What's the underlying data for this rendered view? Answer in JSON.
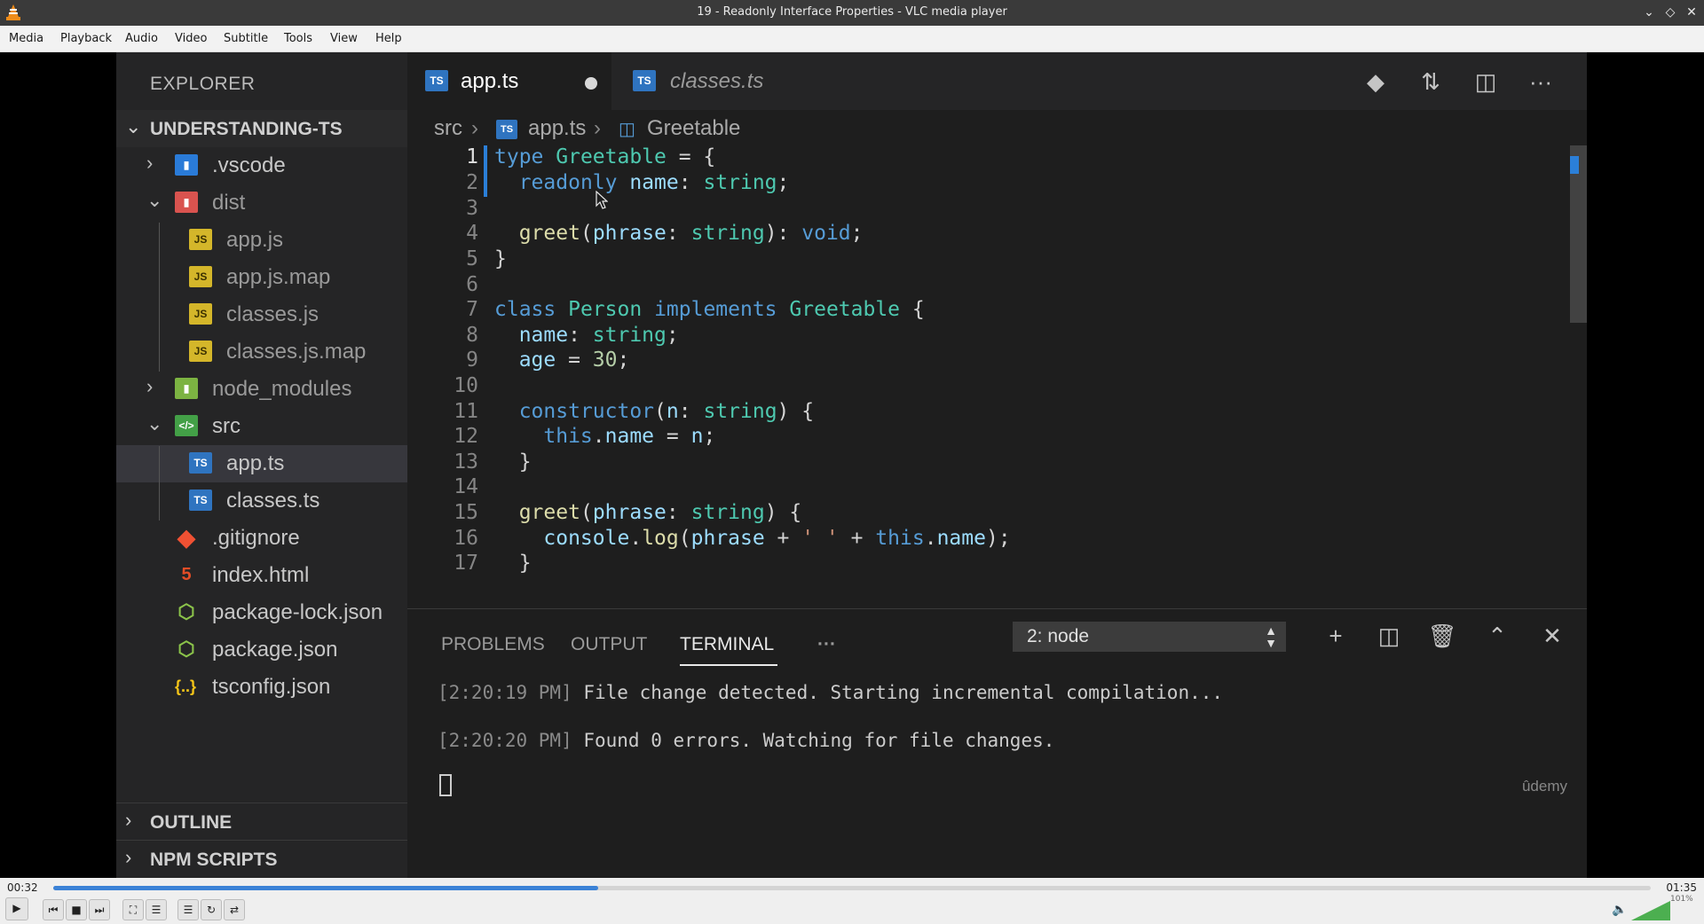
{
  "window": {
    "title": "19 - Readonly Interface Properties - VLC media player"
  },
  "menu": [
    "Media",
    "Playback",
    "Audio",
    "Video",
    "Subtitle",
    "Tools",
    "View",
    "Help"
  ],
  "explorer": {
    "title": "EXPLORER",
    "project": "UNDERSTANDING-TS",
    "items": [
      {
        "label": ".vscode",
        "icon": "folder-vscode-icon"
      },
      {
        "label": "dist",
        "icon": "folder-dist-icon"
      },
      {
        "label": "app.js",
        "icon": "js-file-icon",
        "badge": "JS"
      },
      {
        "label": "app.js.map",
        "icon": "js-map-file-icon",
        "badge": "JS"
      },
      {
        "label": "classes.js",
        "icon": "js-file-icon",
        "badge": "JS"
      },
      {
        "label": "classes.js.map",
        "icon": "js-map-file-icon",
        "badge": "JS"
      },
      {
        "label": "node_modules",
        "icon": "folder-node-icon"
      },
      {
        "label": "src",
        "icon": "folder-src-icon"
      },
      {
        "label": "app.ts",
        "icon": "ts-file-icon",
        "badge": "TS"
      },
      {
        "label": "classes.ts",
        "icon": "ts-file-icon",
        "badge": "TS"
      },
      {
        "label": ".gitignore",
        "icon": "git-icon"
      },
      {
        "label": "index.html",
        "icon": "html5-icon"
      },
      {
        "label": "package-lock.json",
        "icon": "npm-json-icon"
      },
      {
        "label": "package.json",
        "icon": "npm-json-icon"
      },
      {
        "label": "tsconfig.json",
        "icon": "json-braces-icon",
        "badge": "{..}"
      }
    ],
    "outline": "OUTLINE",
    "npm_scripts": "NPM SCRIPTS"
  },
  "tabs": [
    {
      "label": "app.ts",
      "badge": "TS"
    },
    {
      "label": "classes.ts",
      "badge": "TS"
    }
  ],
  "breadcrumb": {
    "folder": "src",
    "file": "app.ts",
    "symbol": "Greetable",
    "file_badge": "TS"
  },
  "editor": {
    "line_numbers": [
      "1",
      "2",
      "3",
      "4",
      "5",
      "6",
      "7",
      "8",
      "9",
      "10",
      "11",
      "12",
      "13",
      "14",
      "15",
      "16",
      "17"
    ]
  },
  "panel": {
    "tabs": [
      "PROBLEMS",
      "OUTPUT",
      "TERMINAL"
    ],
    "more": "···",
    "terminal_select": "2: node",
    "lines": [
      {
        "time": "[2:20:19 PM]",
        "text": " File change detected. Starting incremental compilation..."
      },
      {
        "time": "[2:20:20 PM]",
        "text": " Found 0 errors. Watching for file changes."
      }
    ],
    "watermark": "ûdemy"
  },
  "player": {
    "time_current": "00:32",
    "time_total": "01:35",
    "progress": 0.341,
    "volume_label": "101%",
    "volume": 1.01
  },
  "colors": {
    "accent": "#3b82d6",
    "editor_bg": "#1e1e1e",
    "sidebar_bg": "#252526",
    "keyword": "#569cd6",
    "type": "#4ec9b0",
    "function": "#dcdcaa"
  }
}
